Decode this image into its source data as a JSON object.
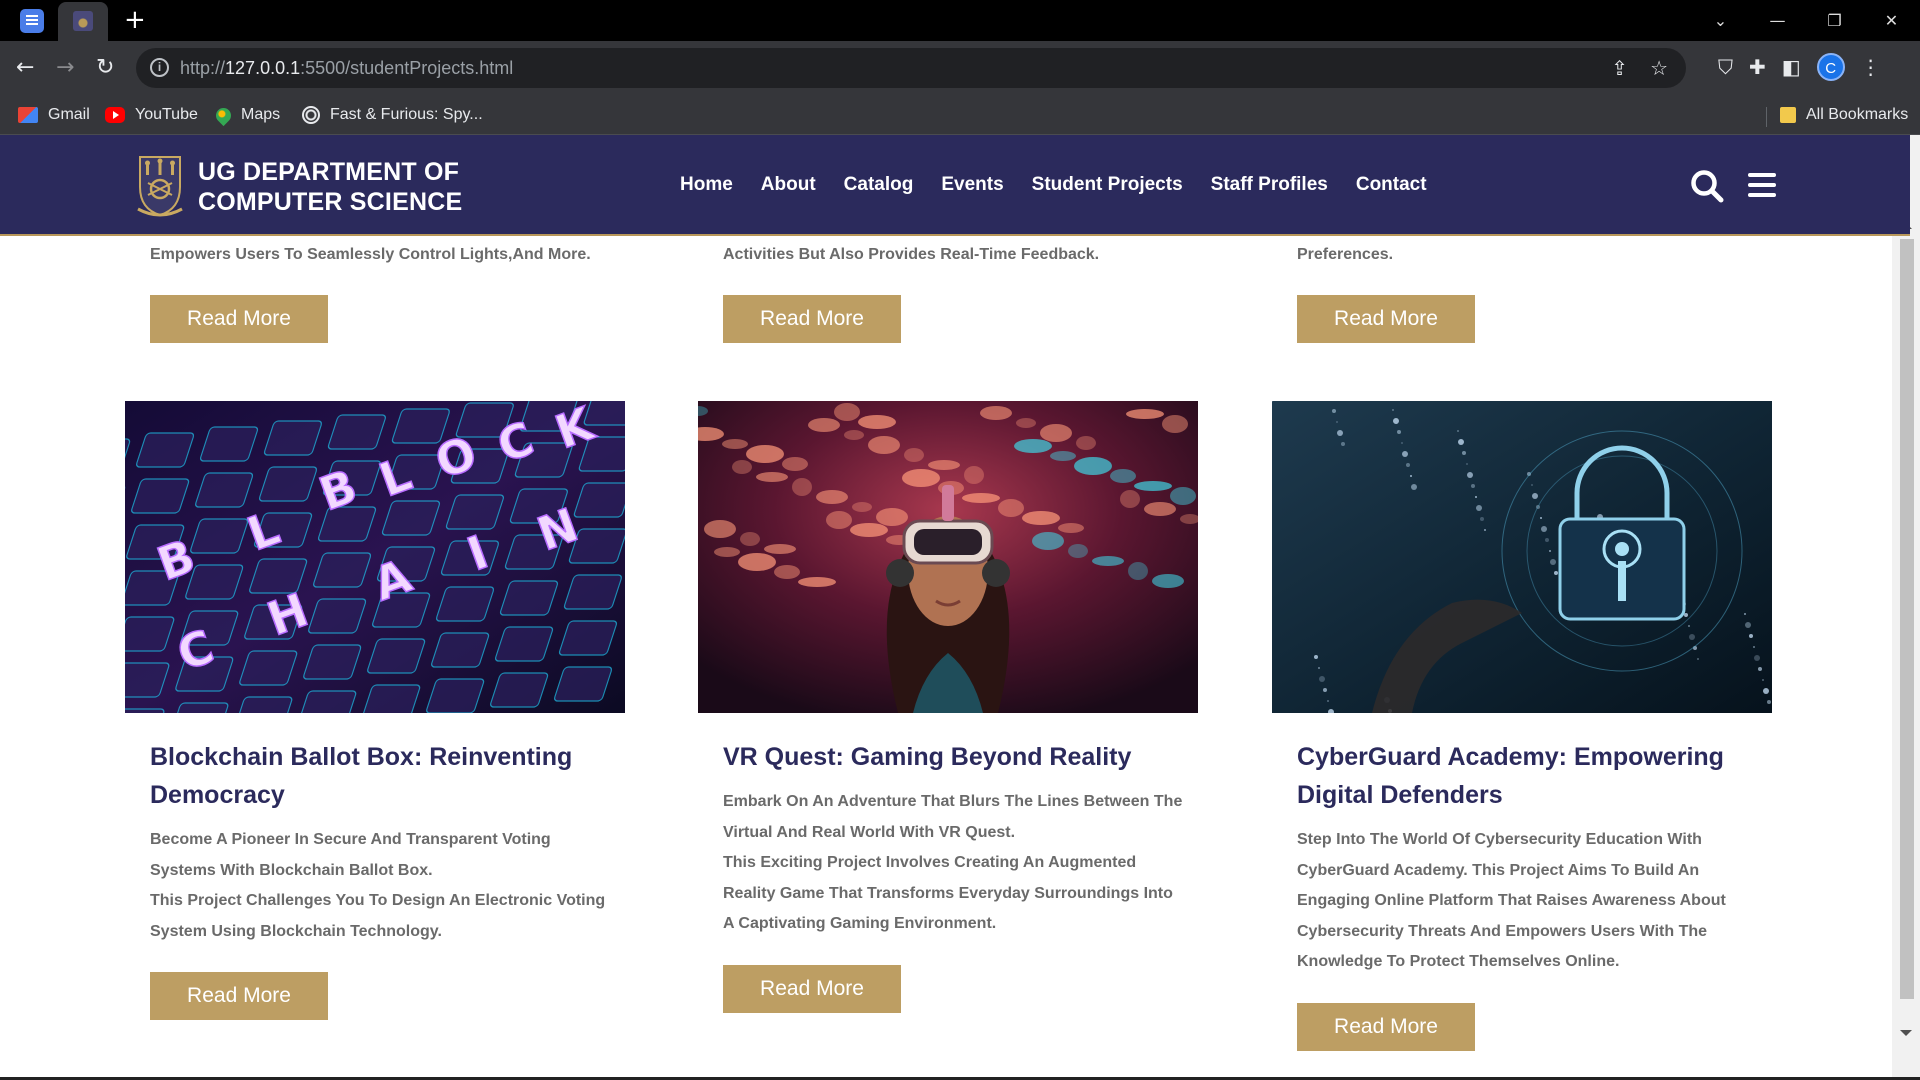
{
  "browser": {
    "address_scheme": "http://",
    "address_host": "127.0.0.1",
    "address_path": ":5500/studentProjects.html",
    "profile_initial": "C",
    "bookmarks": [
      {
        "label": "Gmail",
        "icon": "gmail-icon"
      },
      {
        "label": "YouTube",
        "icon": "youtube-icon"
      },
      {
        "label": "Maps",
        "icon": "maps-icon"
      },
      {
        "label": "Fast & Furious: Spy...",
        "icon": "globe-icon"
      }
    ],
    "all_bookmarks": "All Bookmarks"
  },
  "site": {
    "brand_line1": "UG DEPARTMENT OF",
    "brand_line2": "COMPUTER SCIENCE",
    "nav": [
      "Home",
      "About",
      "Catalog",
      "Events",
      "Student Projects",
      "Staff Profiles",
      "Contact"
    ],
    "primary_color": "#2b2a5c",
    "accent_color": "#bd9e63"
  },
  "previous_row": {
    "desc_endings": [
      "Empowers Users To Seamlessly Control Lights,And More.",
      "Activities But Also Provides Real-Time Feedback.",
      "Preferences."
    ]
  },
  "read_more": "Read More",
  "projects": [
    {
      "title": "Blockchain Ballot Box: Reinventing Democracy",
      "desc": [
        "Become A Pioneer In Secure And Transparent Voting Systems With Blockchain Ballot Box.",
        "This Project Challenges You To Design An Electronic Voting System Using Blockchain Technology."
      ],
      "image": "blockchain keyboard image"
    },
    {
      "title": "VR Quest: Gaming Beyond Reality",
      "desc": [
        "Embark On An Adventure That Blurs The Lines Between The Virtual And Real World With VR Quest.",
        "This Exciting Project Involves Creating An Augmented Reality Game That Transforms Everyday Surroundings Into A Captivating Gaming Environment."
      ],
      "image": "woman wearing VR headset image"
    },
    {
      "title": "CyberGuard Academy: Empowering Digital Defenders",
      "desc": [
        "Step Into The World Of Cybersecurity Education With CyberGuard Academy. This Project Aims To Build An Engaging Online Platform That Raises Awareness About Cybersecurity Threats And Empowers Users With The Knowledge To Protect Themselves Online."
      ],
      "image": "digital padlock image"
    }
  ]
}
